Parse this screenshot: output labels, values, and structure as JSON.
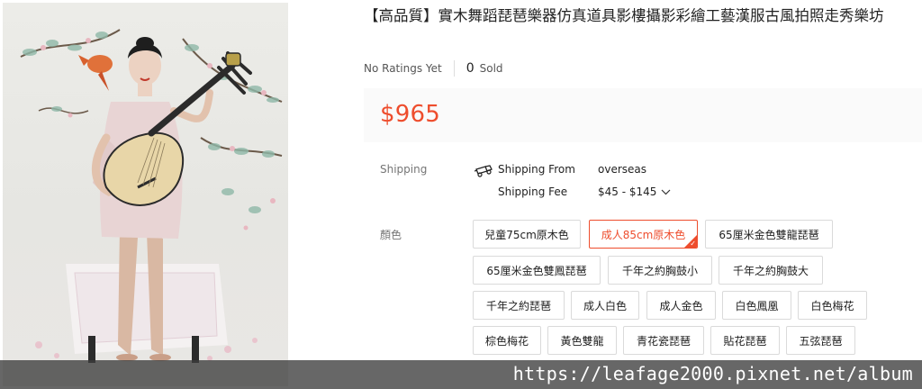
{
  "product": {
    "title": "【高品質】實木舞蹈琵琶樂器仿真道具影樓攝影彩繪工藝漢服古風拍照走秀樂坊",
    "ratings_text": "No Ratings Yet",
    "sold_count": "0",
    "sold_label": "Sold",
    "price": "$965"
  },
  "shipping": {
    "label": "Shipping",
    "icon": "truck-icon",
    "from_label": "Shipping From",
    "from_value": "overseas",
    "fee_label": "Shipping Fee",
    "fee_value": "$45 - $145"
  },
  "variation": {
    "label": "顏色",
    "options": [
      "兒童75cm原木色",
      "成人85cm原木色",
      "65厘米金色雙龍琵琶",
      "65厘米金色雙鳳琵琶",
      "千年之約胸鼓小",
      "千年之約胸鼓大",
      "千年之約琵琶",
      "成人白色",
      "成人金色",
      "白色鳳凰",
      "白色梅花",
      "棕色梅花",
      "黃色雙龍",
      "青花瓷琵琶",
      "貼花琵琶",
      "五弦琵琶"
    ],
    "selected_index": 1
  },
  "watermark": "https://leafage2000.pixnet.net/album",
  "colors": {
    "accent": "#ee4d2d",
    "price_panel_bg": "#fafafa",
    "watermark_bg": "#3c3c3c"
  }
}
